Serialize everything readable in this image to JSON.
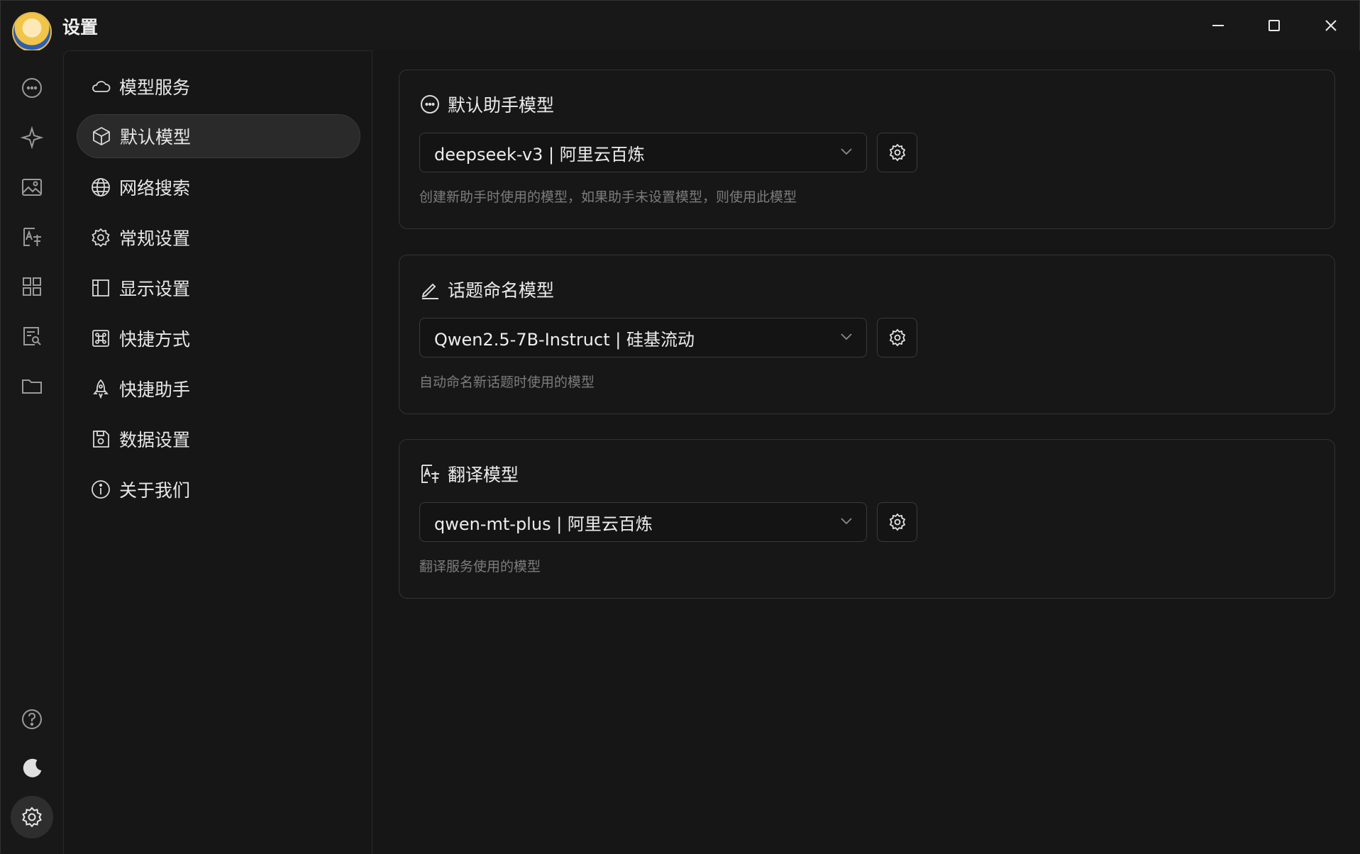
{
  "window": {
    "title": "设置"
  },
  "rail": {
    "items": [
      {
        "icon": "chat-bubble-icon"
      },
      {
        "icon": "sparkle-icon"
      },
      {
        "icon": "image-icon"
      },
      {
        "icon": "translate-icon"
      },
      {
        "icon": "apps-grid-icon"
      },
      {
        "icon": "document-search-icon"
      },
      {
        "icon": "folder-icon"
      }
    ],
    "bottom": [
      {
        "icon": "help-circle-icon"
      },
      {
        "icon": "moon-icon"
      },
      {
        "icon": "gear-icon",
        "active": true
      }
    ]
  },
  "menu": {
    "items": [
      {
        "label": "模型服务",
        "icon": "cloud-icon"
      },
      {
        "label": "默认模型",
        "icon": "cube-icon",
        "active": true
      },
      {
        "label": "网络搜索",
        "icon": "globe-icon"
      },
      {
        "label": "常规设置",
        "icon": "gear-icon"
      },
      {
        "label": "显示设置",
        "icon": "layout-icon"
      },
      {
        "label": "快捷方式",
        "icon": "command-key-icon"
      },
      {
        "label": "快捷助手",
        "icon": "rocket-icon"
      },
      {
        "label": "数据设置",
        "icon": "save-disk-icon"
      },
      {
        "label": "关于我们",
        "icon": "info-icon"
      }
    ]
  },
  "cards": [
    {
      "title": "默认助手模型",
      "icon": "chat-bubble-icon",
      "value": "deepseek-v3 | 阿里云百炼",
      "desc": "创建新助手时使用的模型，如果助手未设置模型，则使用此模型"
    },
    {
      "title": "话题命名模型",
      "icon": "pencil-icon",
      "value": "Qwen2.5-7B-Instruct | 硅基流动",
      "desc": "自动命名新话题时使用的模型"
    },
    {
      "title": "翻译模型",
      "icon": "translate-icon",
      "value": "qwen-mt-plus | 阿里云百炼",
      "desc": "翻译服务使用的模型"
    }
  ],
  "colors": {
    "background": "#181818",
    "accent": "#e8e8e8",
    "muted": "#7c7c7c"
  }
}
